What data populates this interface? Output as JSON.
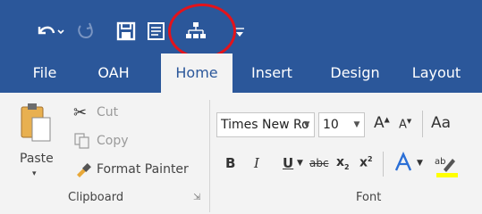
{
  "tabs": [
    "File",
    "OAH",
    "Home",
    "Insert",
    "Design",
    "Layout"
  ],
  "clipboard": {
    "paste": "Paste",
    "cut": "Cut",
    "copy": "Copy",
    "format_painter": "Format Painter",
    "group_label": "Clipboard"
  },
  "font": {
    "name": "Times New Ro",
    "size": "10",
    "group_label": "Font",
    "bold": "B",
    "italic": "I",
    "underline": "U",
    "strike": "abc",
    "sub": "x",
    "sup": "x",
    "grow": "A",
    "shrink": "A",
    "change_case": "Aa"
  },
  "colors": {
    "titlebar": "#2b579a",
    "ribbon": "#f3f3f3",
    "highlight_ring": "#e3131b"
  }
}
